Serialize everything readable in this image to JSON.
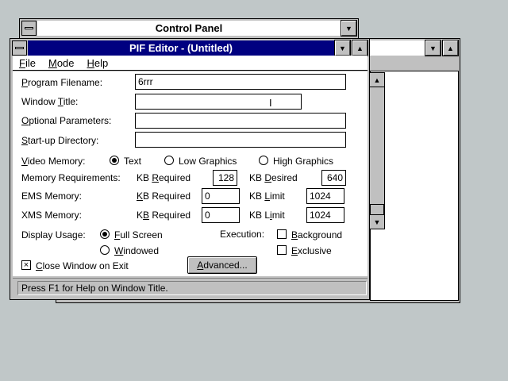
{
  "background_window": {
    "title": "Control Panel"
  },
  "pif_editor": {
    "title": "PIF Editor - (Untitled)",
    "menu": [
      "File",
      "Mode",
      "Help"
    ],
    "program_filename": {
      "label": "Program Filename:",
      "value": "6rrr"
    },
    "window_title": {
      "label": "Window Title:",
      "value": ""
    },
    "optional_parameters": {
      "label": "Optional Parameters:",
      "value": ""
    },
    "startup_directory": {
      "label": "Start-up Directory:",
      "value": ""
    },
    "video_memory": {
      "label": "Video Memory:",
      "options": [
        "Text",
        "Low Graphics",
        "High Graphics"
      ],
      "selected": "Text"
    },
    "memory_requirements": {
      "label": "Memory Requirements:",
      "kb_required_label": "KB Required",
      "kb_required": "128",
      "kb_desired_label": "KB Desired",
      "kb_desired": "640"
    },
    "ems_memory": {
      "label": "EMS Memory:",
      "kb_required_label": "KB Required",
      "kb_required": "0",
      "kb_limit_label": "KB Limit",
      "kb_limit": "1024"
    },
    "xms_memory": {
      "label": "XMS Memory:",
      "kb_required_label": "KB Required",
      "kb_required": "0",
      "kb_limit_label": "KB Limit",
      "kb_limit": "1024"
    },
    "display_usage": {
      "label": "Display Usage:",
      "options": [
        "Full Screen",
        "Windowed"
      ],
      "selected": "Full Screen"
    },
    "execution": {
      "label": "Execution:",
      "background": "Background",
      "exclusive": "Exclusive"
    },
    "close_window_on_exit": "Close Window on Exit",
    "advanced_button": "Advanced...",
    "status": "Press F1 for Help on Window Title."
  }
}
